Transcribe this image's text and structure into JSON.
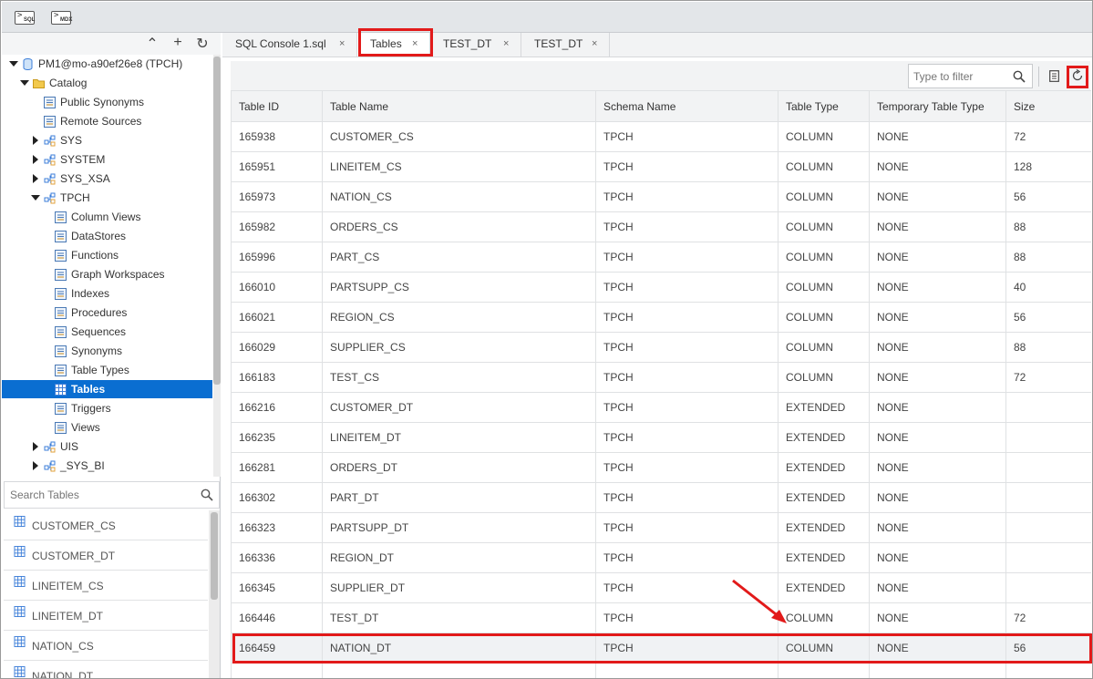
{
  "topbar": {
    "sql_icon": "SQL",
    "mdx_icon": "MDX"
  },
  "tree": [
    {
      "label": "PM1@mo-a90ef26e8 (TPCH)",
      "level": 0,
      "toggle": "down",
      "icon": "database-icon"
    },
    {
      "label": "Catalog",
      "level": 1,
      "toggle": "down",
      "icon": "folder-icon"
    },
    {
      "label": "Public Synonyms",
      "level": 2,
      "toggle": "",
      "icon": "synonym-icon"
    },
    {
      "label": "Remote Sources",
      "level": 2,
      "toggle": "",
      "icon": "remote-source-icon"
    },
    {
      "label": "SYS",
      "level": 2,
      "toggle": "right",
      "icon": "schema-icon"
    },
    {
      "label": "SYSTEM",
      "level": 2,
      "toggle": "right",
      "icon": "schema-icon"
    },
    {
      "label": "SYS_XSA",
      "level": 2,
      "toggle": "right",
      "icon": "schema-icon"
    },
    {
      "label": "TPCH",
      "level": 2,
      "toggle": "down",
      "icon": "schema-icon"
    },
    {
      "label": "Column Views",
      "level": 3,
      "toggle": "",
      "icon": "column-view-icon"
    },
    {
      "label": "DataStores",
      "level": 3,
      "toggle": "",
      "icon": "datastore-icon"
    },
    {
      "label": "Functions",
      "level": 3,
      "toggle": "",
      "icon": "function-icon"
    },
    {
      "label": "Graph Workspaces",
      "level": 3,
      "toggle": "",
      "icon": "graph-icon"
    },
    {
      "label": "Indexes",
      "level": 3,
      "toggle": "",
      "icon": "index-icon"
    },
    {
      "label": "Procedures",
      "level": 3,
      "toggle": "",
      "icon": "procedure-icon"
    },
    {
      "label": "Sequences",
      "level": 3,
      "toggle": "",
      "icon": "sequence-icon"
    },
    {
      "label": "Synonyms",
      "level": 3,
      "toggle": "",
      "icon": "synonym-icon"
    },
    {
      "label": "Table Types",
      "level": 3,
      "toggle": "",
      "icon": "table-type-icon"
    },
    {
      "label": "Tables",
      "level": 3,
      "toggle": "",
      "icon": "table-icon",
      "selected": true
    },
    {
      "label": "Triggers",
      "level": 3,
      "toggle": "",
      "icon": "trigger-icon"
    },
    {
      "label": "Views",
      "level": 3,
      "toggle": "",
      "icon": "view-icon"
    },
    {
      "label": "UIS",
      "level": 2,
      "toggle": "right",
      "icon": "schema-icon"
    },
    {
      "label": "_SYS_BI",
      "level": 2,
      "toggle": "right",
      "icon": "schema-icon"
    }
  ],
  "search_tables": {
    "placeholder": "Search Tables"
  },
  "table_list": [
    "CUSTOMER_CS",
    "CUSTOMER_DT",
    "LINEITEM_CS",
    "LINEITEM_DT",
    "NATION_CS",
    "NATION_DT"
  ],
  "tabs": [
    {
      "label": "SQL Console 1.sql",
      "close": "×"
    },
    {
      "label": "Tables",
      "close": "×",
      "active": true
    },
    {
      "label": "TEST_DT",
      "close": "×"
    },
    {
      "label": "TEST_DT",
      "close": "×"
    }
  ],
  "filter": {
    "placeholder": "Type to filter"
  },
  "grid": {
    "columns": [
      "Table ID",
      "Table Name",
      "Schema Name",
      "Table Type",
      "Temporary Table Type",
      "Size"
    ],
    "rows": [
      [
        "165938",
        "CUSTOMER_CS",
        "TPCH",
        "COLUMN",
        "NONE",
        "72"
      ],
      [
        "165951",
        "LINEITEM_CS",
        "TPCH",
        "COLUMN",
        "NONE",
        "128"
      ],
      [
        "165973",
        "NATION_CS",
        "TPCH",
        "COLUMN",
        "NONE",
        "56"
      ],
      [
        "165982",
        "ORDERS_CS",
        "TPCH",
        "COLUMN",
        "NONE",
        "88"
      ],
      [
        "165996",
        "PART_CS",
        "TPCH",
        "COLUMN",
        "NONE",
        "88"
      ],
      [
        "166010",
        "PARTSUPP_CS",
        "TPCH",
        "COLUMN",
        "NONE",
        "40"
      ],
      [
        "166021",
        "REGION_CS",
        "TPCH",
        "COLUMN",
        "NONE",
        "56"
      ],
      [
        "166029",
        "SUPPLIER_CS",
        "TPCH",
        "COLUMN",
        "NONE",
        "88"
      ],
      [
        "166183",
        "TEST_CS",
        "TPCH",
        "COLUMN",
        "NONE",
        "72"
      ],
      [
        "166216",
        "CUSTOMER_DT",
        "TPCH",
        "EXTENDED",
        "NONE",
        ""
      ],
      [
        "166235",
        "LINEITEM_DT",
        "TPCH",
        "EXTENDED",
        "NONE",
        ""
      ],
      [
        "166281",
        "ORDERS_DT",
        "TPCH",
        "EXTENDED",
        "NONE",
        ""
      ],
      [
        "166302",
        "PART_DT",
        "TPCH",
        "EXTENDED",
        "NONE",
        ""
      ],
      [
        "166323",
        "PARTSUPP_DT",
        "TPCH",
        "EXTENDED",
        "NONE",
        ""
      ],
      [
        "166336",
        "REGION_DT",
        "TPCH",
        "EXTENDED",
        "NONE",
        ""
      ],
      [
        "166345",
        "SUPPLIER_DT",
        "TPCH",
        "EXTENDED",
        "NONE",
        ""
      ],
      [
        "166446",
        "TEST_DT",
        "TPCH",
        "COLUMN",
        "NONE",
        "72"
      ],
      [
        "166459",
        "NATION_DT",
        "TPCH",
        "COLUMN",
        "NONE",
        "56"
      ],
      [
        "",
        "",
        "",
        "",
        "",
        ""
      ]
    ],
    "highlighted_row": 17
  },
  "colors": {
    "selection": "#0a6ed1",
    "annotation_red": "#e21a1a",
    "folder": "#f2c94c",
    "schema_blue": "#3b7dd8"
  }
}
